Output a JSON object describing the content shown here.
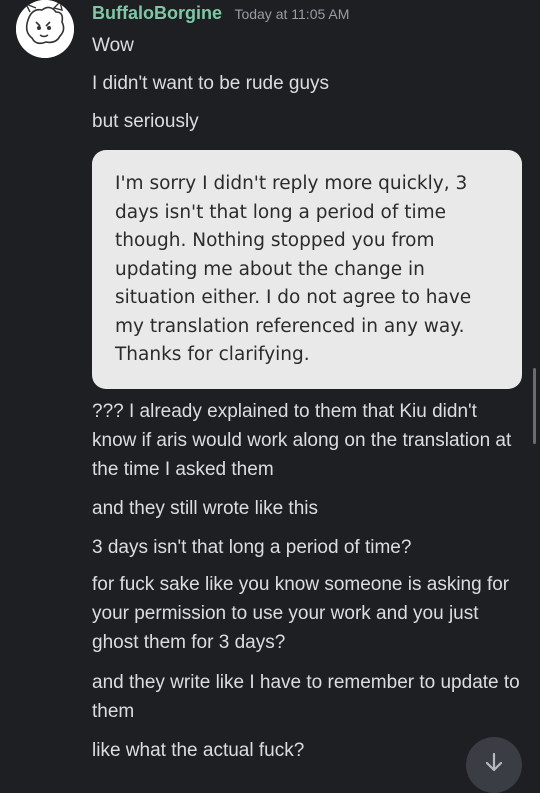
{
  "message": {
    "author": "BuffaloBorgine",
    "timestamp": "Today at 11:05 AM",
    "lines": [
      "Wow",
      "I didn't want to be rude guys",
      "but seriously"
    ],
    "quoted_screenshot_text": "I'm sorry I didn't reply more quickly, 3 days isn't that long a period of time though. Nothing stopped you from updating me about the change in situation either. I do not agree to have my translation referenced in any way. Thanks for clarifying.",
    "followups": [
      "??? I already explained to them that Kiu didn't know if aris would work along on the translation at the time I asked them",
      "and they still wrote like this",
      "3 days isn't that long a period of time?",
      "for fuck sake like you know someone is asking for your permission to use your work and you just ghost them for 3 days?",
      "and they write like I have to remember to update to them",
      "like what the actual fuck?"
    ]
  },
  "icons": {
    "avatar": "avatar-drawing",
    "jump": "arrow-down-icon"
  },
  "colors": {
    "background": "#1e1f22",
    "username": "#7ec8a6",
    "text": "#dbdee1",
    "quote_bg": "#e9e9ea"
  }
}
